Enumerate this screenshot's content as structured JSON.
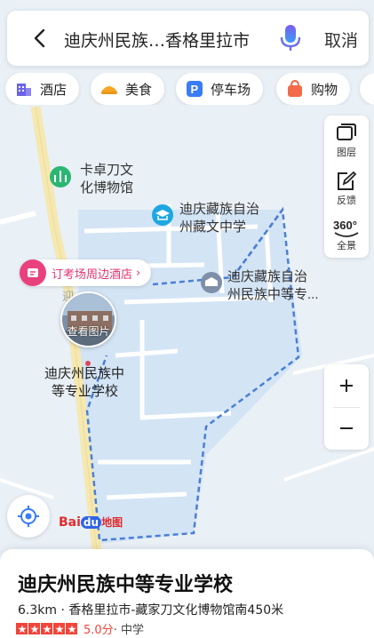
{
  "search": {
    "query": "迪庆州民族…香格里拉市",
    "cancel_label": "取消"
  },
  "categories": [
    {
      "label": "酒店",
      "icon": "hotel-icon",
      "color": "#6b63e8"
    },
    {
      "label": "美食",
      "icon": "food-icon",
      "color": "#f5a623"
    },
    {
      "label": "停车场",
      "icon": "parking-icon",
      "color": "#3a7cf6"
    },
    {
      "label": "购物",
      "icon": "shopping-icon",
      "color": "#f26b4a"
    }
  ],
  "map_tools": {
    "layers_label": "图层",
    "feedback_label": "反馈",
    "panorama_label": "全景",
    "panorama_badge": "360°"
  },
  "map_labels": {
    "museum": "卡卓刀文\n化博物馆",
    "middle_school": "迪庆藏族自治\n州藏文中学",
    "vocational_school": "迪庆藏族自治\n州民族中等专...",
    "hotel_promo": "订考场周边酒店",
    "photo_caption": "查看图片",
    "selected_place": "迪庆州民族中\n等专业学校"
  },
  "logo": {
    "bai": "Bai",
    "du": "du",
    "map": "地图"
  },
  "place": {
    "name": "迪庆州民族中等专业学校",
    "subtitle": "6.3km · 香格里拉市-藏家刀文化博物馆南450米",
    "rating": 5.0,
    "score_text": "5.0分",
    "category": "· 中学"
  },
  "colors": {
    "accent": "#3a7cf6",
    "boundary": "#4a7fd4",
    "hotel": "#e9417d",
    "rating": "#f2443a"
  }
}
